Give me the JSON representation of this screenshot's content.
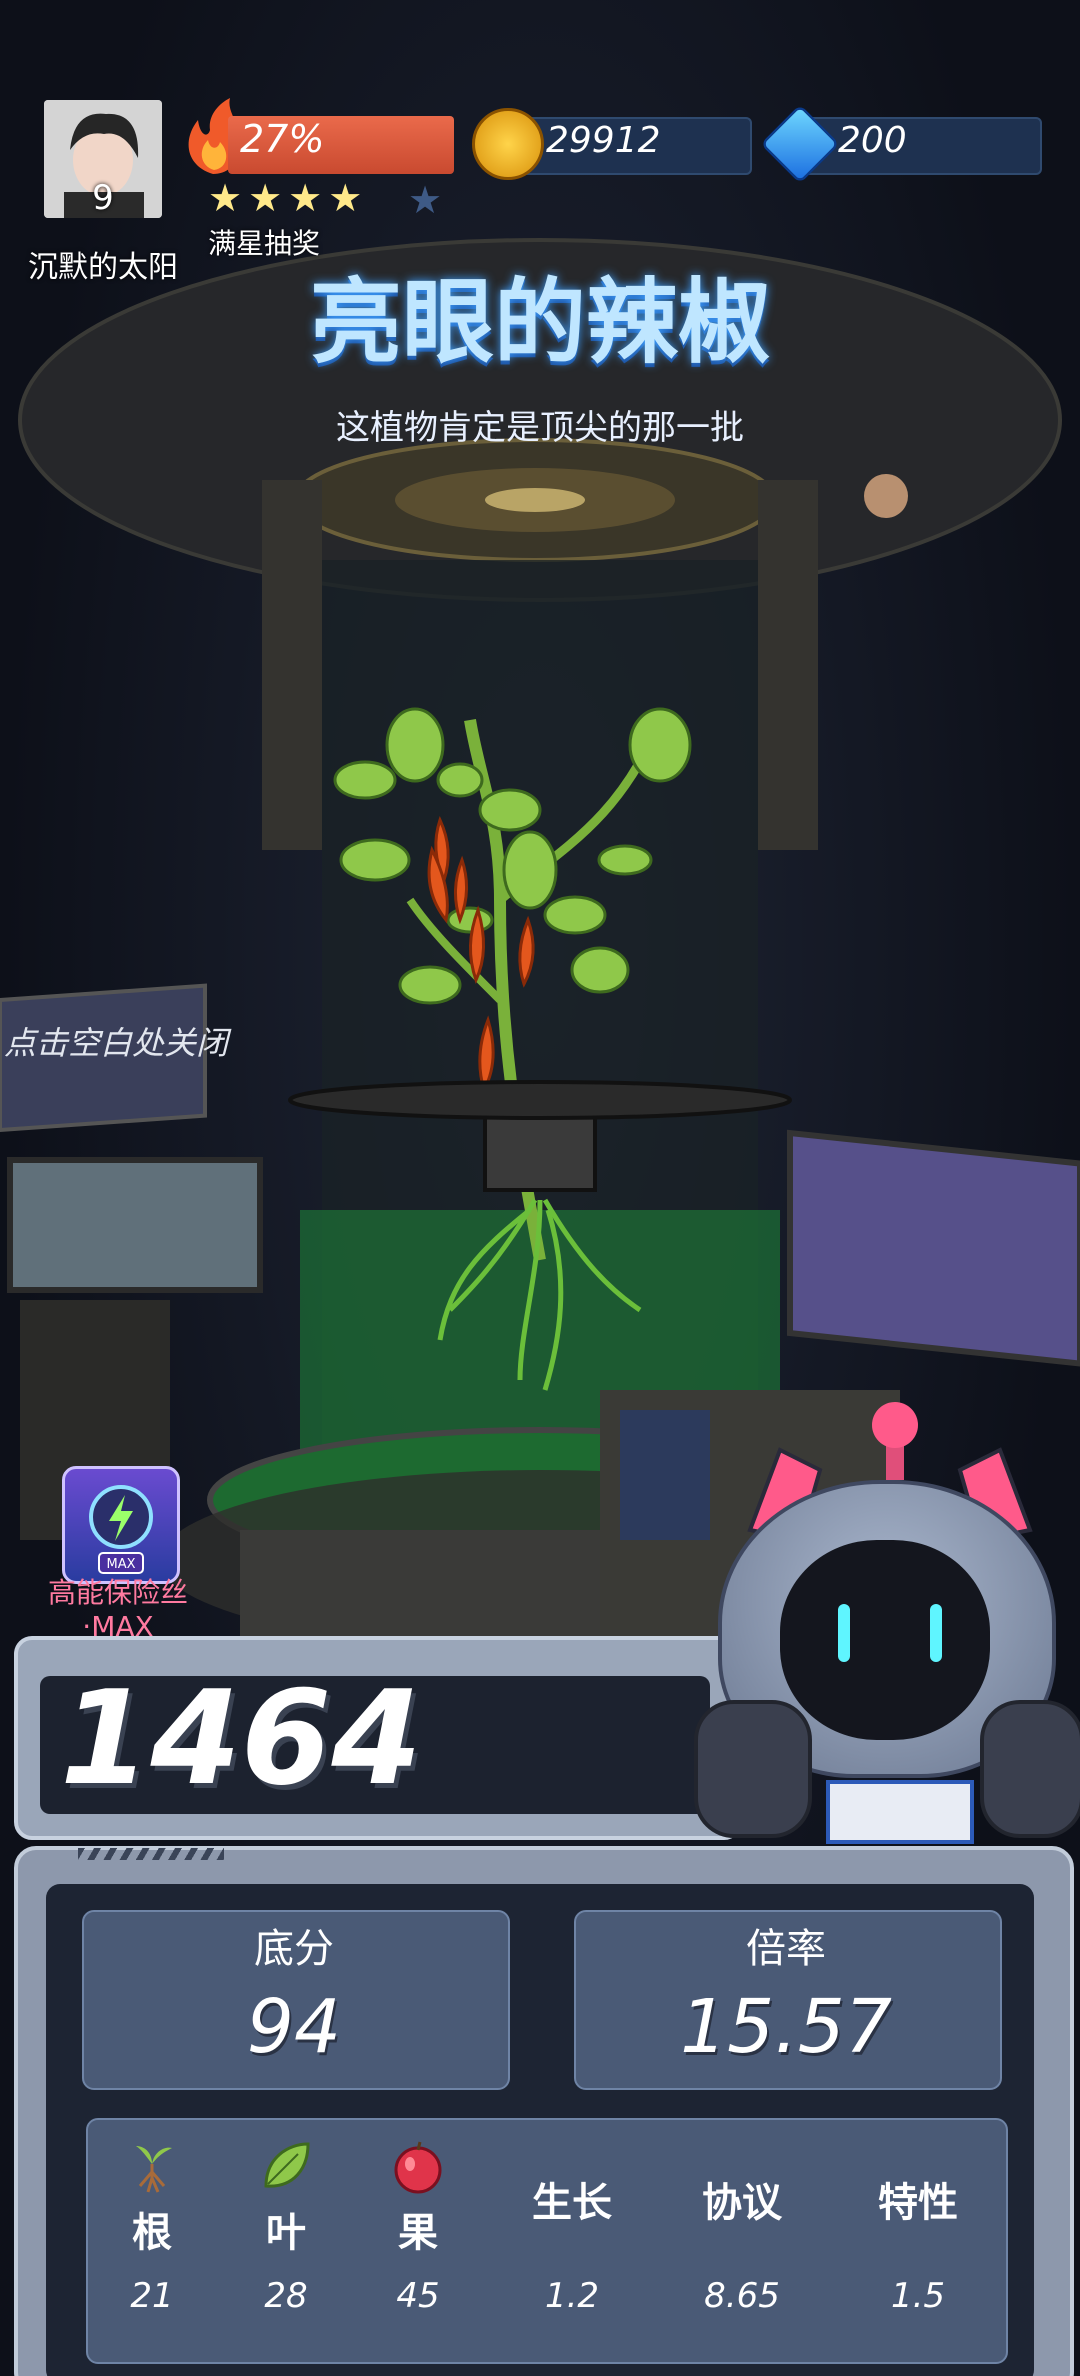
{
  "player": {
    "name": "沉默的太阳",
    "level": "9",
    "heat_percent": "27%",
    "stars": "★★★★",
    "star_reward_label": "满星抽奖"
  },
  "resources": {
    "coins": "29912",
    "gems": "200"
  },
  "result": {
    "plant_title": "亮眼的辣椒",
    "plant_comment": "这植物肯定是顶尖的那一批"
  },
  "close_hint": "点击空白处关闭",
  "buff": {
    "label_line1": "高能保险丝",
    "label_line2": "·MAX",
    "badge": "MAX"
  },
  "score": {
    "total": "1464",
    "base_label": "底分",
    "base_value": "94",
    "multiplier_label": "倍率",
    "multiplier_value": "15.57"
  },
  "attributes": [
    {
      "label": "根",
      "value": "21",
      "icon": "root-icon"
    },
    {
      "label": "叶",
      "value": "28",
      "icon": "leaf-icon"
    },
    {
      "label": "果",
      "value": "45",
      "icon": "fruit-icon"
    },
    {
      "label": "生长",
      "value": "1.2"
    },
    {
      "label": "协议",
      "value": "8.65"
    },
    {
      "label": "特性",
      "value": "1.5"
    }
  ],
  "colors": {
    "heat_bar": "#d9583a",
    "title_glow": "#3fa0ff",
    "panel": "#4a5a76",
    "robot_accent": "#ff5a8a"
  }
}
